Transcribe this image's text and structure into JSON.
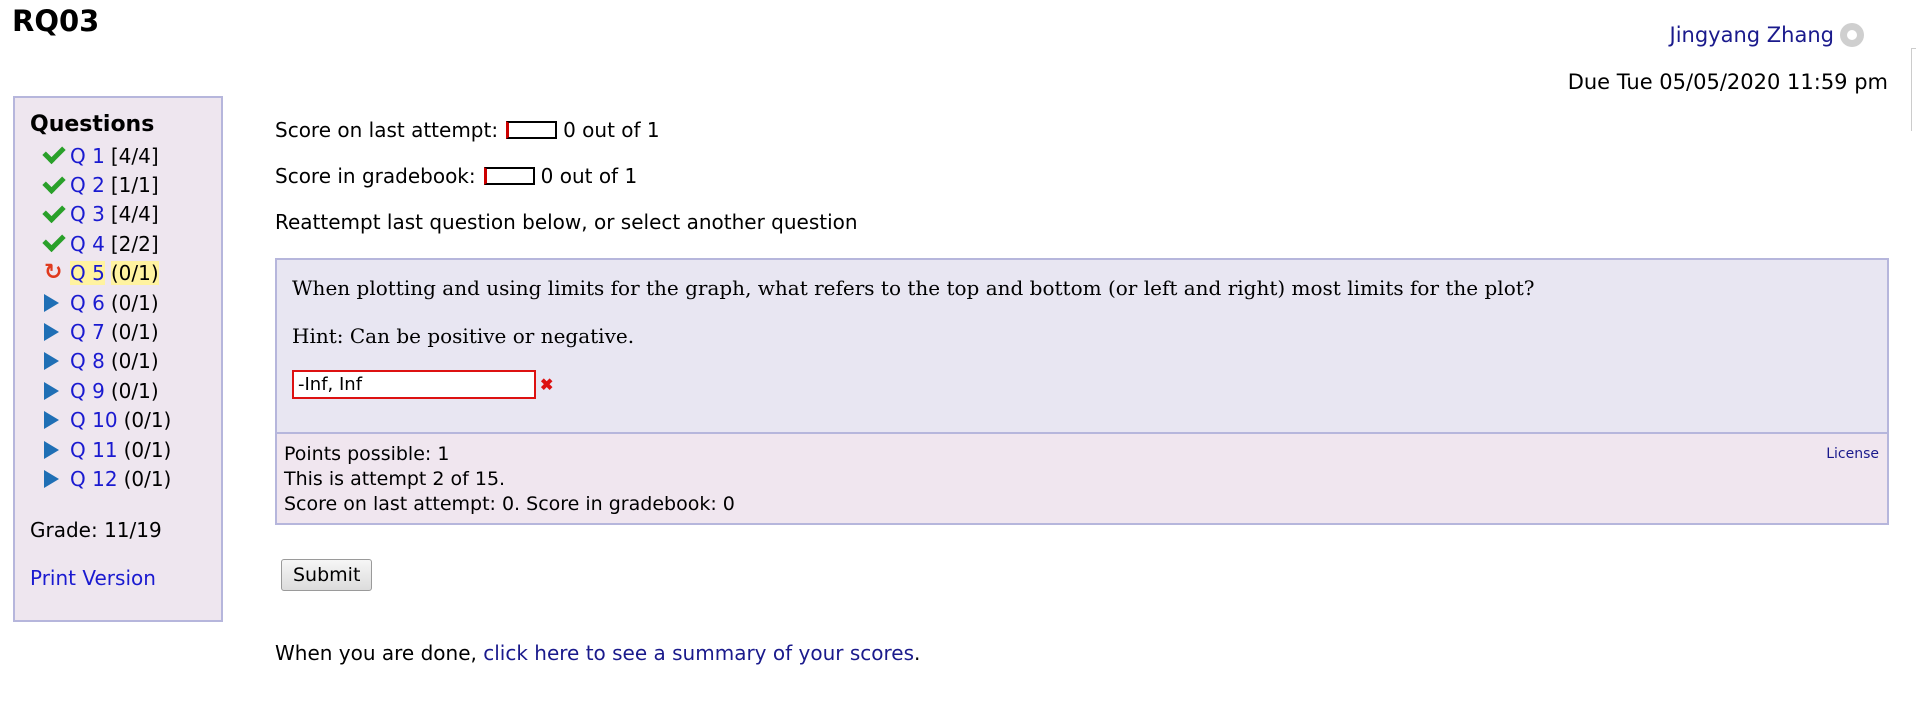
{
  "page": {
    "title": "RQ03"
  },
  "header": {
    "user_name": "Jingyang Zhang",
    "due": "Due Tue 05/05/2020 11:59 pm"
  },
  "sidebar": {
    "heading": "Questions",
    "items": [
      {
        "label": "Q 1",
        "score": "[4/4]",
        "status": "check-icon"
      },
      {
        "label": "Q 2",
        "score": "[1/1]",
        "status": "check-icon"
      },
      {
        "label": "Q 3",
        "score": "[4/4]",
        "status": "check-icon"
      },
      {
        "label": "Q 4",
        "score": "[2/2]",
        "status": "check-icon"
      },
      {
        "label": "Q 5",
        "score": "(0/1)",
        "status": "retry-icon"
      },
      {
        "label": "Q 6",
        "score": "(0/1)",
        "status": "play-icon"
      },
      {
        "label": "Q 7",
        "score": "(0/1)",
        "status": "play-icon"
      },
      {
        "label": "Q 8",
        "score": "(0/1)",
        "status": "play-icon"
      },
      {
        "label": "Q 9",
        "score": "(0/1)",
        "status": "play-icon"
      },
      {
        "label": "Q 10",
        "score": "(0/1)",
        "status": "play-icon"
      },
      {
        "label": "Q 11",
        "score": "(0/1)",
        "status": "play-icon"
      },
      {
        "label": "Q 12",
        "score": "(0/1)",
        "status": "play-icon"
      }
    ],
    "grade": "Grade: 11/19",
    "print_link": "Print Version"
  },
  "main": {
    "last_attempt_label": "Score on last attempt:",
    "last_attempt_value": "0 out of 1",
    "gradebook_label": "Score in gradebook:",
    "gradebook_value": "0 out of 1",
    "instruction": "Reattempt last question below, or select another question"
  },
  "question": {
    "text": "When plotting and using limits for the graph, what refers to the top and bottom (or left and right) most limits for the plot?",
    "hint": "Hint: Can be positive or negative.",
    "answer_value": "-Inf, Inf",
    "points_possible": "Points possible: 1",
    "attempt": "This is attempt 2 of 15.",
    "score_summary": "Score on last attempt: 0. Score in gradebook: 0",
    "license_label": "License"
  },
  "actions": {
    "submit_label": "Submit"
  },
  "footer": {
    "done_prefix": "When you are done, ",
    "summary_link": "click here to see a summary of your scores",
    "done_suffix": "."
  },
  "colors": {
    "correct": "#2aa02a",
    "retry": "#e03a1e",
    "pending": "#1f6fb5",
    "link": "#1a1ad0",
    "current_highlight": "#fff3a0"
  }
}
